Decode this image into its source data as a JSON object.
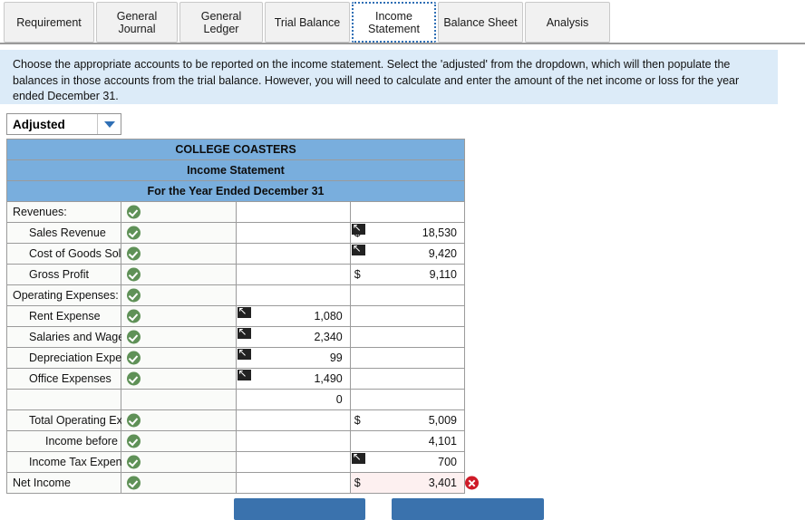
{
  "tabs": [
    {
      "label": "Requirement",
      "active": false
    },
    {
      "label": "General\nJournal",
      "active": false
    },
    {
      "label": "General\nLedger",
      "active": false
    },
    {
      "label": "Trial Balance",
      "active": false
    },
    {
      "label": "Income\nStatement",
      "active": true
    },
    {
      "label": "Balance Sheet",
      "active": false
    },
    {
      "label": "Analysis",
      "active": false
    }
  ],
  "banner": {
    "text": "Choose the appropriate accounts to be reported on the income statement. Select the 'adjusted' from the dropdown, which will then populate the balances in those accounts from the trial balance. However, you will need to calculate and enter the amount of the net income or loss for the year ended December 31."
  },
  "dropdown": {
    "value": "Adjusted",
    "icon": "chevron-down-icon"
  },
  "statement": {
    "title_lines": [
      "COLLEGE COASTERS",
      "Income Statement",
      "For the Year Ended December 31"
    ],
    "rows": [
      {
        "label": "Revenues:",
        "indent": 0,
        "check": true,
        "mid": "",
        "mid_ref": false,
        "right": "",
        "right_cur": "",
        "right_ref": false,
        "topline": false,
        "error": false
      },
      {
        "label": "Sales Revenue",
        "indent": 1,
        "check": true,
        "mid": "",
        "mid_ref": false,
        "right": "18,530",
        "right_cur": "$",
        "right_ref": true,
        "topline": false,
        "error": false
      },
      {
        "label": "Cost of Goods Sold",
        "indent": 1,
        "check": true,
        "mid": "",
        "mid_ref": false,
        "right": "9,420",
        "right_cur": "",
        "right_ref": true,
        "topline": false,
        "error": false
      },
      {
        "label": "Gross Profit",
        "indent": 1,
        "check": true,
        "mid": "",
        "mid_ref": false,
        "right": "9,110",
        "right_cur": "$",
        "right_ref": false,
        "topline": true,
        "error": false
      },
      {
        "label": "Operating Expenses:",
        "indent": 0,
        "check": true,
        "mid": "",
        "mid_ref": false,
        "right": "",
        "right_cur": "",
        "right_ref": false,
        "topline": false,
        "error": false
      },
      {
        "label": "Rent Expense",
        "indent": 1,
        "check": true,
        "mid": "1,080",
        "mid_ref": true,
        "right": "",
        "right_cur": "",
        "right_ref": false,
        "topline": false,
        "error": false
      },
      {
        "label": "Salaries and Wages Expense",
        "indent": 1,
        "check": true,
        "mid": "2,340",
        "mid_ref": true,
        "right": "",
        "right_cur": "",
        "right_ref": false,
        "topline": false,
        "error": false
      },
      {
        "label": "Depreciation Expense",
        "indent": 1,
        "check": true,
        "mid": "99",
        "mid_ref": true,
        "right": "",
        "right_cur": "",
        "right_ref": false,
        "topline": false,
        "error": false
      },
      {
        "label": "Office Expenses",
        "indent": 1,
        "check": true,
        "mid": "1,490",
        "mid_ref": true,
        "right": "",
        "right_cur": "",
        "right_ref": false,
        "topline": false,
        "error": false
      },
      {
        "label": "",
        "indent": 0,
        "check": false,
        "mid": "0",
        "mid_ref": false,
        "right": "",
        "right_cur": "",
        "right_ref": false,
        "topline": false,
        "error": false
      },
      {
        "label": "Total Operating Expenses",
        "indent": 1,
        "check": true,
        "mid": "",
        "mid_ref": false,
        "right": "5,009",
        "right_cur": "$",
        "right_ref": false,
        "topline": true,
        "error": false
      },
      {
        "label": "Income before Income Tax Expense",
        "indent": 2,
        "check": true,
        "mid": "",
        "mid_ref": false,
        "right": "4,101",
        "right_cur": "",
        "right_ref": false,
        "topline": false,
        "error": false
      },
      {
        "label": "Income Tax Expense",
        "indent": 1,
        "check": true,
        "mid": "",
        "mid_ref": false,
        "right": "700",
        "right_cur": "",
        "right_ref": true,
        "topline": false,
        "error": false
      },
      {
        "label": "Net Income",
        "indent": 0,
        "check": true,
        "mid": "",
        "mid_ref": false,
        "right": "3,401",
        "right_cur": "$",
        "right_ref": false,
        "topline": true,
        "error": true
      }
    ]
  },
  "footer": {
    "prev_label": "",
    "next_label": ""
  },
  "colors": {
    "header_blue": "#79aedd",
    "banner_blue": "#dcebf8",
    "button_blue": "#3a72ad",
    "check_green": "#5f9157",
    "error_red": "#cf1a27"
  }
}
